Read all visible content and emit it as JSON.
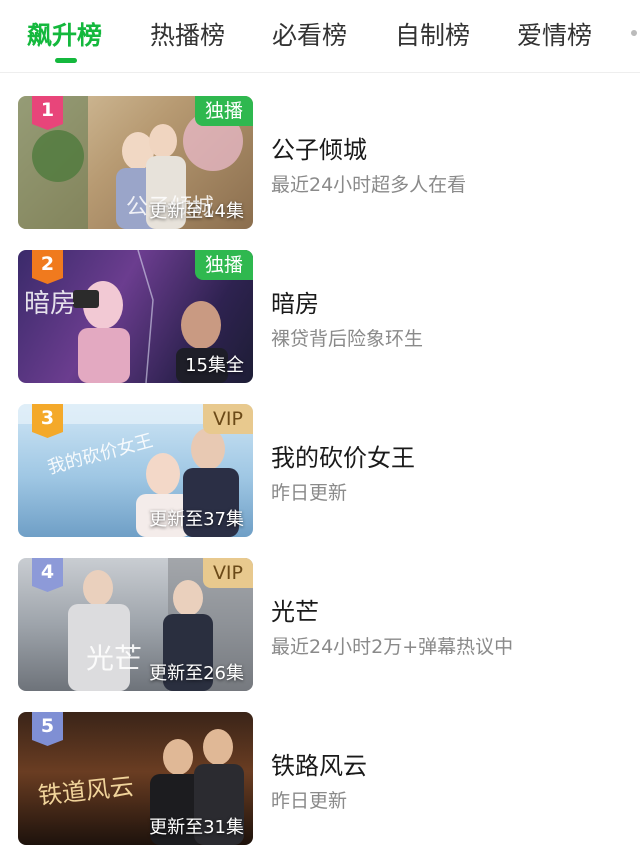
{
  "tabs": [
    {
      "label": "飙升榜",
      "active": true
    },
    {
      "label": "热播榜",
      "active": false
    },
    {
      "label": "必看榜",
      "active": false
    },
    {
      "label": "自制榜",
      "active": false
    },
    {
      "label": "爱情榜",
      "active": false
    }
  ],
  "colors": {
    "accent": "#14b83d",
    "badge_exclusive": "#2fb84f",
    "badge_vip": "#e8c98e",
    "rank_1": "#e8457a",
    "rank_2": "#f07a1e",
    "rank_3": "#f4a92a",
    "rank_4": "#8d9ad8",
    "rank_5": "#7f8fd4"
  },
  "list": [
    {
      "rank": "1",
      "badge": "独播",
      "status": "更新至14集",
      "title": "公子倾城",
      "subtitle": "最近24小时超多人在看",
      "poster_art_text": "公子倾城"
    },
    {
      "rank": "2",
      "badge": "独播",
      "status": "15集全",
      "title": "暗房",
      "subtitle": "裸贷背后险象环生",
      "poster_art_text": "暗房"
    },
    {
      "rank": "3",
      "badge": "VIP",
      "status": "更新至37集",
      "title": "我的砍价女王",
      "subtitle": "昨日更新",
      "poster_art_text": "我的砍价女王"
    },
    {
      "rank": "4",
      "badge": "VIP",
      "status": "更新至26集",
      "title": "光芒",
      "subtitle": "最近24小时2万+弹幕热议中",
      "poster_art_text": "光芒"
    },
    {
      "rank": "5",
      "badge": "",
      "status": "更新至31集",
      "title": "铁路风云",
      "subtitle": "昨日更新",
      "poster_art_text": "铁道风云"
    }
  ]
}
